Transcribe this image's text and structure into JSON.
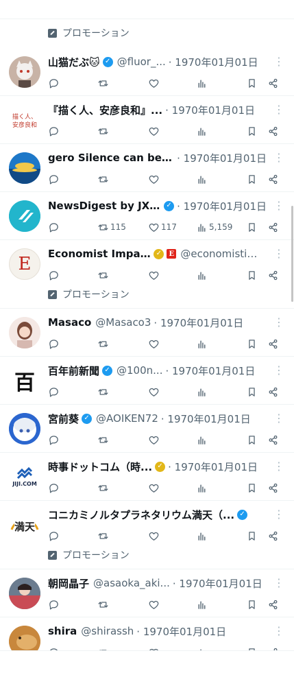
{
  "promo_label": "プロモーション",
  "colors": {
    "accent": "#1d9bf0",
    "gold": "#e2b719",
    "muted": "#536471"
  },
  "icons": {
    "reply": "reply-icon",
    "retweet": "retweet-icon",
    "like": "heart-icon",
    "views": "views-icon",
    "bookmark": "bookmark-icon",
    "share": "share-icon",
    "more": "more-icon",
    "promo": "promoted-icon"
  },
  "tweets": [
    {
      "name": "山猫だぶ🐱",
      "handle": "@fluor_...",
      "date": "· 1970年01月01日",
      "badge": "blue"
    },
    {
      "name": "『描く人、安彦良和』...",
      "handle": "",
      "date": "· 1970年01月01日",
      "badge": "",
      "avatar_text": "描く人、安彦良和"
    },
    {
      "name": "gero Silence can be v...",
      "handle": "",
      "date": "· 1970年01月01日",
      "badge": ""
    },
    {
      "name": "NewsDigest by JX...",
      "handle": "",
      "date": "· 1970年01月01日",
      "badge": "blue",
      "retweets": "115",
      "likes": "117",
      "views": "5,159"
    },
    {
      "name": "Economist Impact",
      "handle": "@economistim...",
      "date": "",
      "badge": "gold",
      "badge_square": "E",
      "avatar_text": "E"
    },
    {
      "name": "Masaco",
      "handle": "@Masaco3",
      "date": "· 1970年01月01日",
      "badge": ""
    },
    {
      "name": "百年前新聞",
      "handle": "@100n...",
      "date": "· 1970年01月01日",
      "badge": "blue",
      "avatar_text": "百"
    },
    {
      "name": "宮前葵",
      "handle": "@AOIKEN72",
      "date": "· 1970年01月01日",
      "badge": "blue"
    },
    {
      "name": "時事ドットコム（時...",
      "handle": "",
      "date": "· 1970年01月01日",
      "badge": "gold",
      "avatar_text": "JIJI.COM"
    },
    {
      "name": "コニカミノルタプラネタリウム満天（...",
      "handle": "",
      "date": "",
      "badge": "blue",
      "avatar_text": "満天"
    },
    {
      "name": "朝岡晶子",
      "handle": "@asaoka_aki...",
      "date": "· 1970年01月01日",
      "badge": ""
    },
    {
      "name": "shira",
      "handle": "@shirassh",
      "date": "· 1970年01月01日",
      "badge": ""
    }
  ]
}
